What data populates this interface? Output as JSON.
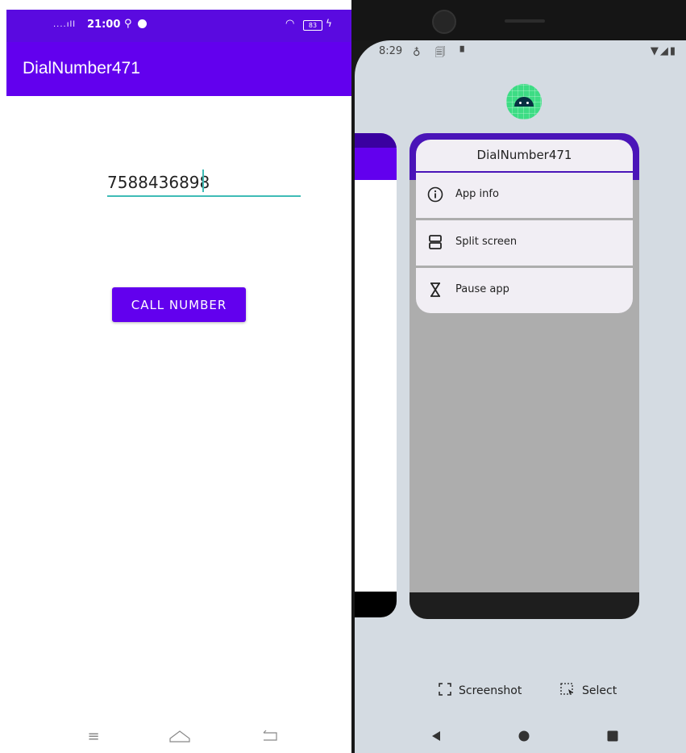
{
  "left": {
    "status": {
      "signal": "....ıll",
      "time": "21:00",
      "battery": "83",
      "usb_icon": "usb-icon",
      "wifi_icon": "wifi-icon"
    },
    "app_title": "DialNumber471",
    "phone_input": {
      "value": "7588436898"
    },
    "call_button": "CALL NUMBER",
    "nav": {
      "menu_icon": "≡",
      "home_icon": "⌂",
      "back_icon": "↩"
    }
  },
  "right": {
    "status": {
      "time": "8:29",
      "left_icons": "♁ 🗐 ▘",
      "right_icons": "▼◢▮"
    },
    "app_icon": "android-icon",
    "menu": {
      "title": "DialNumber471",
      "items": [
        {
          "label": "App info",
          "icon": "info-icon"
        },
        {
          "label": "Split screen",
          "icon": "split-screen-icon"
        },
        {
          "label": "Pause app",
          "icon": "hourglass-icon"
        }
      ]
    },
    "actions": {
      "screenshot": "Screenshot",
      "select": "Select"
    },
    "nav": {
      "back": "◀",
      "home": "●",
      "recents": "■"
    }
  },
  "colors": {
    "primary": "#6200ee",
    "status_left": "#5a0ae0",
    "teal": "#3fbcb6",
    "screen_bg": "#d4dbe2",
    "menu_bg": "#f1eef4"
  }
}
